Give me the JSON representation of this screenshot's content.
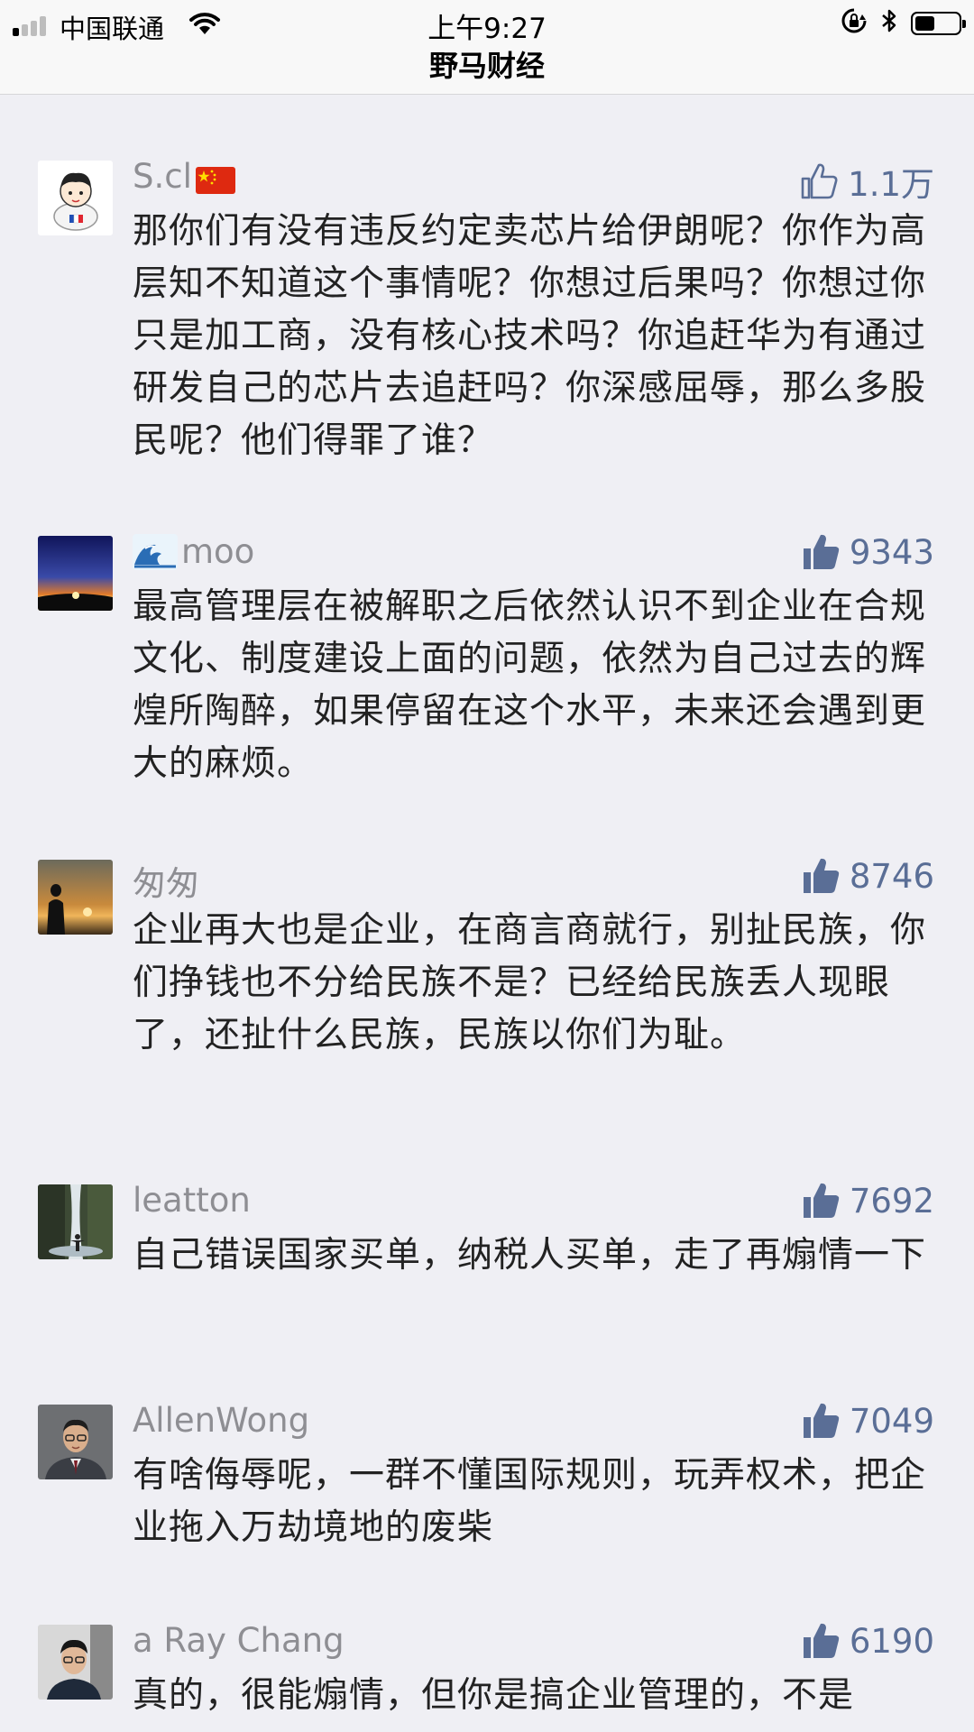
{
  "status_bar": {
    "carrier": "中国联通",
    "time": "上午9:27",
    "battery_level": 0.45
  },
  "header": {
    "title": "野马财经"
  },
  "comments": [
    {
      "username": "S.cl",
      "username_flag": "china-flag-icon",
      "likes": "1.1万",
      "like_icon": "thumbs-up-outline-icon",
      "text": "那你们有没有违反约定卖芯片给伊朗呢？你作为高层知不知道这个事情呢？你想过后果吗？你想过你只是加工商，没有核心技术吗？你追赶华为有通过研发自己的芯片去追赶吗？你深感屈辱，那么多股民呢？他们得罪了谁？"
    },
    {
      "username": "moo",
      "username_prefix": "wave-emoji-icon",
      "likes": "9343",
      "like_icon": "thumbs-up-filled-icon",
      "text": "最高管理层在被解职之后依然认识不到企业在合规文化、制度建设上面的问题，依然为自己过去的辉煌所陶醉，如果停留在这个水平，未来还会遇到更大的麻烦。"
    },
    {
      "username": "匆匆",
      "likes": "8746",
      "like_icon": "thumbs-up-filled-icon",
      "text": "企业再大也是企业，在商言商就行，别扯民族，你们挣钱也不分给民族不是？已经给民族丢人现眼了，还扯什么民族，民族以你们为耻。"
    },
    {
      "username": "leatton",
      "likes": "7692",
      "like_icon": "thumbs-up-filled-icon",
      "text": "自己错误国家买单，纳税人买单，走了再煽情一下"
    },
    {
      "username": "AllenWong",
      "likes": "7049",
      "like_icon": "thumbs-up-filled-icon",
      "text": "有啥侮辱呢，一群不懂国际规则，玩弄权术，把企业拖入万劫境地的废柴"
    },
    {
      "username": "a Ray Chang",
      "likes": "6190",
      "like_icon": "thumbs-up-filled-icon",
      "text": "真的，很能煽情，但你是搞企业管理的，不是"
    }
  ],
  "colors": {
    "background": "#efeff4",
    "like_blue": "#5a6e96",
    "username_gray": "#8e8e93"
  }
}
